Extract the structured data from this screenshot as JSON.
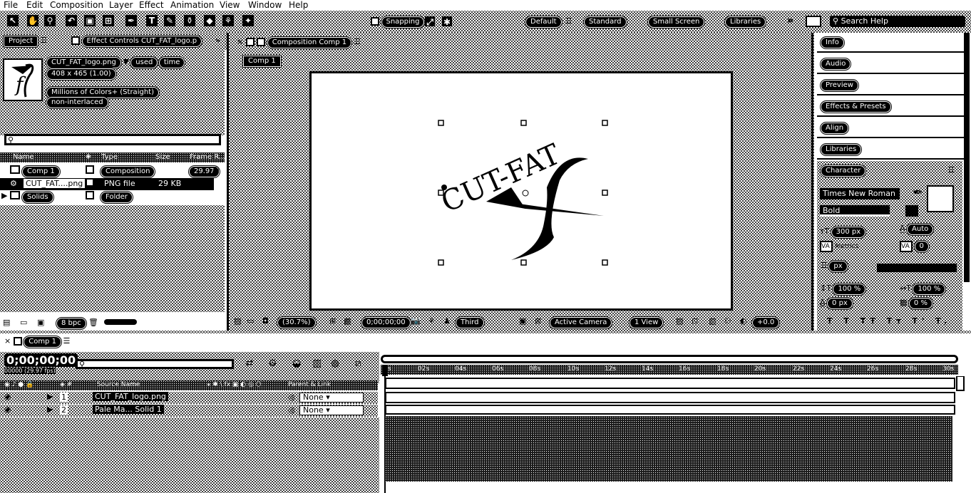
{
  "menu": [
    "File",
    "Edit",
    "Composition",
    "Layer",
    "Effect",
    "Animation",
    "View",
    "Window",
    "Help"
  ],
  "toolbar": {
    "snapping": "Snapping",
    "workspaces": [
      "Default",
      "Standard",
      "Small Screen",
      "Libraries"
    ],
    "search_placeholder": "Search Help"
  },
  "project": {
    "tab_project": "Project",
    "tab_effects": "Effect Controls CUT_FAT_logo.p",
    "asset": {
      "name": "CUT_FAT_logo.png",
      "used": "used",
      "times": "time",
      "dims": "408 x 465 (1.00)",
      "colors": "Millions of Colors+ (Straight)",
      "interlace": "non-interlaced"
    },
    "columns": {
      "name": "Name",
      "type": "Type",
      "size": "Size",
      "frame_rate": "Frame R..."
    },
    "items": [
      {
        "name": "Comp 1",
        "type": "Composition",
        "size": "",
        "fps": "29.97"
      },
      {
        "name": "CUT_FAT....png",
        "type": "PNG file",
        "size": "29 KB",
        "fps": ""
      },
      {
        "name": "Solids",
        "type": "Folder",
        "size": "",
        "fps": ""
      }
    ],
    "footer_bpc": "8 bpc"
  },
  "viewer": {
    "tab": "Composition Comp 1",
    "subtab": "Comp 1",
    "logo_text": "CUT-FAT",
    "zoom": "(30.7%)",
    "timecode": "0;00;00;00",
    "resolution": "Third",
    "camera": "Active Camera",
    "views": "1 View",
    "offset": "+0.0"
  },
  "right_panel": {
    "items": [
      "Info",
      "Audio",
      "Preview",
      "Effects & Presets",
      "Align",
      "Libraries"
    ],
    "character": {
      "title": "Character",
      "font": "Times New Roman",
      "style": "Bold",
      "size": "300 px",
      "leading": "Auto",
      "kerning": "Metrics",
      "tracking": "0",
      "stroke": "px",
      "vscale": "100 %",
      "hscale": "100 %",
      "baseline": "0 px",
      "tsume": "0 %"
    }
  },
  "timeline": {
    "tab": "Comp 1",
    "timecode": "0;00;00;00",
    "fps_info": "00000 (29.97 fps)",
    "columns": {
      "source": "Source Name",
      "parent": "Parent & Link"
    },
    "layers": [
      {
        "num": "1",
        "name": "CUT_FAT_logo.png",
        "parent": "None"
      },
      {
        "num": "2",
        "name": "Pale Ma... Solid 1",
        "parent": "None"
      }
    ],
    "ruler": [
      "0s",
      "02s",
      "04s",
      "06s",
      "08s",
      "10s",
      "12s",
      "14s",
      "16s",
      "18s",
      "20s",
      "22s",
      "24s",
      "26s",
      "28s",
      "30s"
    ]
  }
}
